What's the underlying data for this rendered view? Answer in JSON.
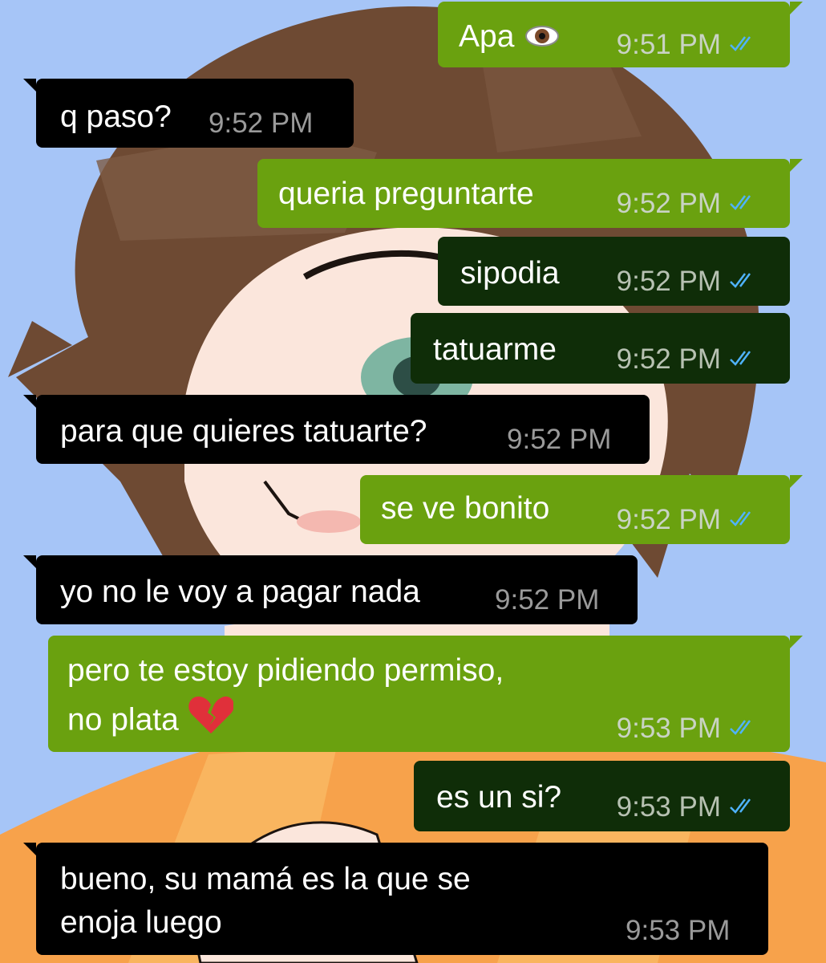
{
  "colors": {
    "wallpaper_bg": "#a6c5f7",
    "outgoing_green": "#6aa10f",
    "outgoing_dark": "#0f2d08",
    "incoming": "#000000",
    "read_ticks": "#4fb3ff"
  },
  "messages": [
    {
      "side": "out",
      "text": "Apa",
      "icon": "eye-emoji",
      "time": "9:51 PM",
      "status": "read"
    },
    {
      "side": "in",
      "text": "q paso?",
      "time": "9:52 PM"
    },
    {
      "side": "out",
      "text": "queria preguntarte",
      "time": "9:52 PM",
      "status": "read"
    },
    {
      "side": "out",
      "text": "sipodia",
      "time": "9:52 PM",
      "status": "read"
    },
    {
      "side": "out",
      "text": "tatuarme",
      "time": "9:52 PM",
      "status": "read"
    },
    {
      "side": "in",
      "text": "para que quieres tatuarte?",
      "time": "9:52 PM"
    },
    {
      "side": "out",
      "text": "se ve bonito",
      "time": "9:52 PM",
      "status": "read"
    },
    {
      "side": "in",
      "text": "yo no le voy a pagar nada",
      "time": "9:52 PM"
    },
    {
      "side": "out",
      "text_line1": "pero te estoy pidiendo permiso,",
      "text_line2": "no plata",
      "icon": "broken-heart-emoji",
      "time": "9:53 PM",
      "status": "read"
    },
    {
      "side": "out",
      "text": "es un si?",
      "time": "9:53 PM",
      "status": "read"
    },
    {
      "side": "in",
      "text_line1": "bueno, su mamá es la que se",
      "text_line2": "enoja luego",
      "time": "9:53 PM"
    }
  ]
}
